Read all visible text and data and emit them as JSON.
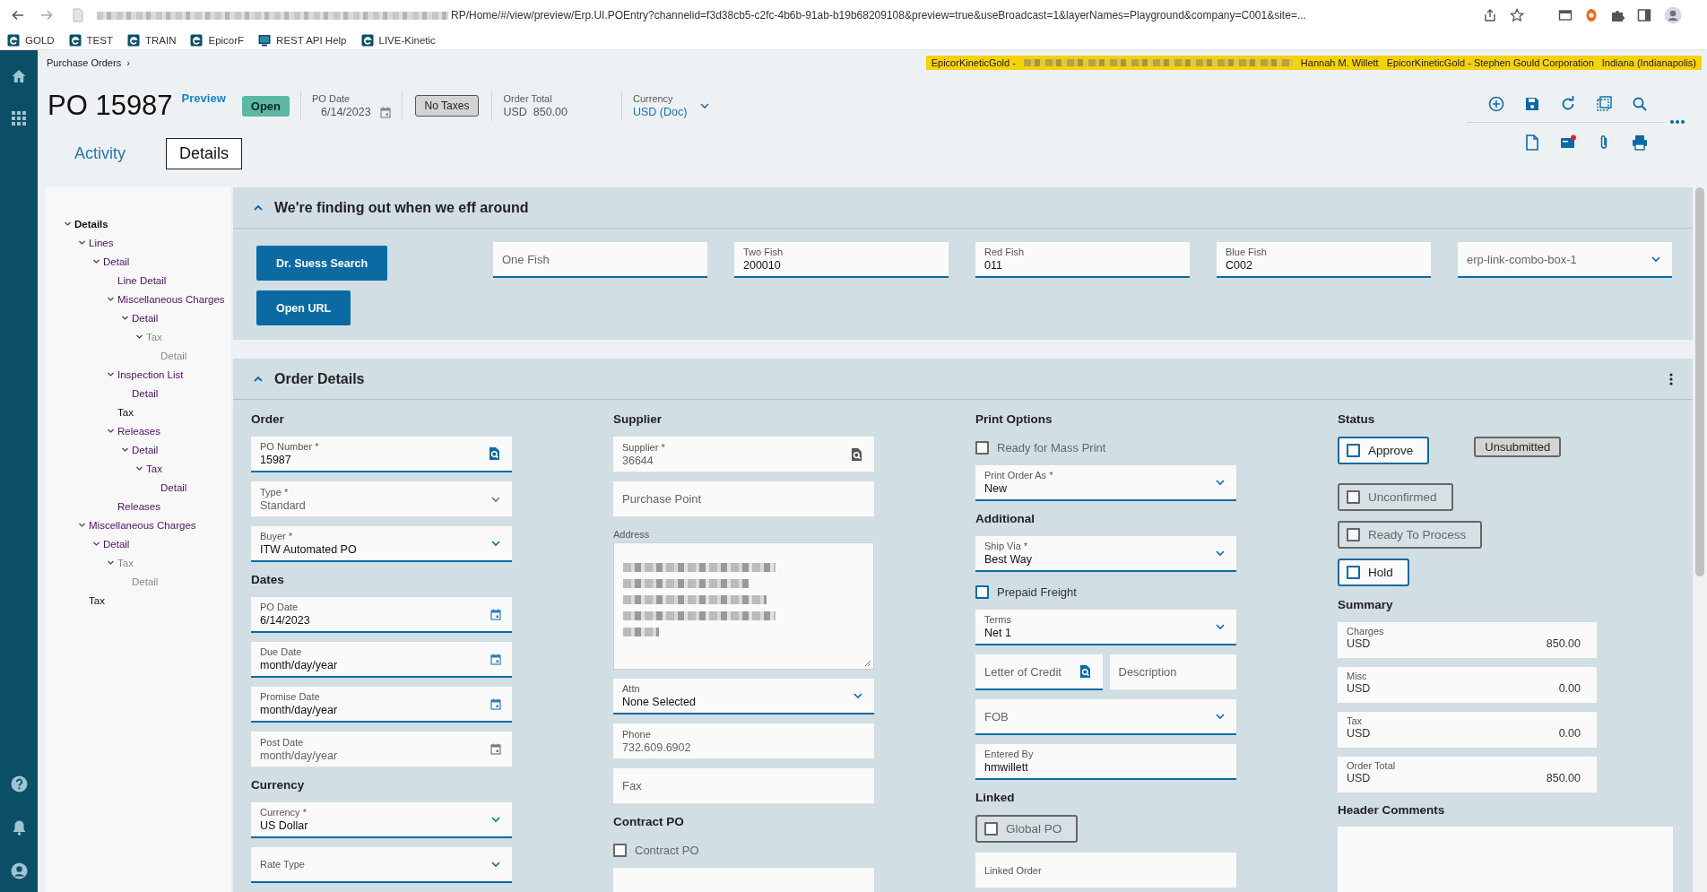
{
  "browser": {
    "url": "RP/Home/#/view/preview/Erp.UI.POEntry?channelid=f3d38cb5-c2fc-4b6b-91ab-b19b68209108&preview=true&useBroadcast=1&layerNames=Playground&company=C001&site=...",
    "bookmarks": [
      {
        "label": "GOLD",
        "kind": "app"
      },
      {
        "label": "TEST",
        "kind": "app"
      },
      {
        "label": "TRAIN",
        "kind": "app"
      },
      {
        "label": "EpicorF",
        "kind": "app"
      },
      {
        "label": "REST API Help",
        "kind": "doc"
      },
      {
        "label": "LIVE-Kinetic",
        "kind": "app"
      }
    ]
  },
  "breadcrumb": {
    "label": "Purchase Orders",
    "separator": "›"
  },
  "banner": {
    "environment": "EpicorKineticGold -",
    "user": "Hannah M. Willett",
    "company": "EpicorKineticGold - Stephen Gould Corporation",
    "site": "Indiana (Indianapolis)"
  },
  "header": {
    "title": "PO 15987",
    "mode": "Preview",
    "status": "Open",
    "po_date": {
      "label": "PO Date",
      "value": "6/14/2023"
    },
    "tax_button": "No Taxes",
    "order_total": {
      "label": "Order Total",
      "value": "USD  850.00"
    },
    "currency": {
      "label": "Currency",
      "value": "USD (Doc)"
    }
  },
  "tabs": [
    {
      "label": "Activity",
      "selected": false
    },
    {
      "label": "Details",
      "selected": true
    }
  ],
  "tree": [
    {
      "label": "Details",
      "selected": true,
      "visited": false,
      "disabled": false,
      "expanded": true,
      "children": [
        {
          "label": "Lines",
          "selected": false,
          "visited": true,
          "disabled": false,
          "expanded": true,
          "children": [
            {
              "label": "Detail",
              "selected": false,
              "visited": true,
              "disabled": false,
              "expanded": true,
              "children": [
                {
                  "label": "Line Detail",
                  "selected": false,
                  "visited": true,
                  "disabled": false
                },
                {
                  "label": "Miscellaneous Charges",
                  "selected": false,
                  "visited": true,
                  "disabled": false,
                  "expanded": true,
                  "children": [
                    {
                      "label": "Detail",
                      "selected": false,
                      "visited": true,
                      "disabled": false,
                      "expanded": true,
                      "children": [
                        {
                          "label": "Tax",
                          "selected": false,
                          "visited": false,
                          "disabled": true,
                          "expanded": true,
                          "children": [
                            {
                              "label": "Detail",
                              "selected": false,
                              "visited": false,
                              "disabled": true
                            }
                          ]
                        }
                      ]
                    }
                  ]
                },
                {
                  "label": "Inspection List",
                  "selected": false,
                  "visited": true,
                  "disabled": false,
                  "expanded": true,
                  "children": [
                    {
                      "label": "Detail",
                      "selected": false,
                      "visited": true,
                      "disabled": false
                    }
                  ]
                },
                {
                  "label": "Tax",
                  "selected": false,
                  "visited": false,
                  "disabled": false
                },
                {
                  "label": "Releases",
                  "selected": false,
                  "visited": true,
                  "disabled": false,
                  "expanded": true,
                  "children": [
                    {
                      "label": "Detail",
                      "selected": false,
                      "visited": true,
                      "disabled": false,
                      "expanded": true,
                      "children": [
                        {
                          "label": "Tax",
                          "selected": false,
                          "visited": true,
                          "disabled": false,
                          "expanded": true,
                          "children": [
                            {
                              "label": "Detail",
                              "selected": false,
                              "visited": true,
                              "disabled": false
                            }
                          ]
                        }
                      ]
                    }
                  ]
                },
                {
                  "label": "Releases",
                  "selected": false,
                  "visited": true,
                  "disabled": false
                }
              ]
            }
          ]
        },
        {
          "label": "Miscellaneous Charges",
          "selected": false,
          "visited": true,
          "disabled": false,
          "expanded": true,
          "children": [
            {
              "label": "Detail",
              "selected": false,
              "visited": true,
              "disabled": false,
              "expanded": true,
              "children": [
                {
                  "label": "Tax",
                  "selected": false,
                  "visited": false,
                  "disabled": true,
                  "expanded": true,
                  "children": [
                    {
                      "label": "Detail",
                      "selected": false,
                      "visited": false,
                      "disabled": true
                    }
                  ]
                }
              ]
            }
          ]
        },
        {
          "label": "Tax",
          "selected": false,
          "visited": false,
          "disabled": false
        }
      ]
    }
  ],
  "panels": [
    {
      "title": "We're finding out when we eff around",
      "expanded": true,
      "buttons": [
        "Dr. Suess Search",
        "Open URL"
      ],
      "fields": [
        {
          "kind": "text",
          "placeholder": "One Fish",
          "disabled": false
        },
        {
          "kind": "text",
          "label": "Two Fish",
          "value": "200010",
          "disabled": false
        },
        {
          "kind": "text",
          "label": "Red Fish",
          "value": "011",
          "disabled": false
        },
        {
          "kind": "text",
          "label": "Blue Fish",
          "value": "C002",
          "disabled": false
        },
        {
          "kind": "dropdown",
          "placeholder": "erp-link-combo-box-1",
          "disabled": false
        }
      ]
    },
    {
      "title": "Order Details",
      "expanded": true,
      "columns": [
        [
          {
            "heading": "Order",
            "items": [
              {
                "kind": "lookup",
                "label": "PO Number *",
                "value": "15987",
                "disabled": false
              },
              {
                "kind": "dropdown",
                "label": "Type *",
                "value": "Standard",
                "disabled": true
              },
              {
                "kind": "dropdown",
                "label": "Buyer *",
                "value": "ITW Automated PO",
                "disabled": false
              }
            ]
          },
          {
            "heading": "Dates",
            "items": [
              {
                "kind": "date",
                "label": "PO Date",
                "value": "6/14/2023",
                "disabled": false
              },
              {
                "kind": "date",
                "label": "Due Date",
                "placeholder": "month/day/year",
                "disabled": false
              },
              {
                "kind": "date",
                "label": "Promise Date",
                "placeholder": "month/day/year",
                "disabled": false
              },
              {
                "kind": "date",
                "label": "Post Date",
                "placeholder": "month/day/year",
                "disabled": true
              }
            ]
          },
          {
            "heading": "Currency",
            "items": [
              {
                "kind": "dropdown",
                "label": "Currency *",
                "value": "US Dollar",
                "disabled": false
              },
              {
                "kind": "dropdown",
                "label": "Rate Type",
                "disabled": false
              }
            ]
          }
        ],
        [
          {
            "heading": "Supplier",
            "items": [
              {
                "kind": "lookup",
                "label": "Supplier *",
                "value": "36644",
                "disabled": true
              },
              {
                "kind": "text",
                "placeholder": "Purchase Point",
                "disabled": true
              },
              {
                "kind": "address",
                "label": "Address",
                "disabled": false
              },
              {
                "kind": "dropdown",
                "label": "Attn",
                "value": "None Selected",
                "disabled": false
              },
              {
                "kind": "text",
                "label": "Phone",
                "value": "732.609.6902",
                "disabled": true
              },
              {
                "kind": "text",
                "placeholder": "Fax",
                "disabled": true
              }
            ]
          },
          {
            "heading": "Contract PO",
            "items": [
              {
                "kind": "checkbox",
                "label": "Contract PO",
                "checked": false,
                "disabled": true
              },
              {
                "kind": "text",
                "disabled": true
              }
            ]
          }
        ],
        [
          {
            "heading": "Print Options",
            "items": [
              {
                "kind": "checkbox",
                "label": "Ready for Mass Print",
                "checked": false,
                "disabled": true
              },
              {
                "kind": "dropdown",
                "label": "Print Order As *",
                "value": "New",
                "disabled": false
              }
            ]
          },
          {
            "heading": "Additional",
            "items": [
              {
                "kind": "dropdown",
                "label": "Ship Via *",
                "value": "Best Way",
                "disabled": false
              },
              {
                "kind": "checkbox",
                "label": "Prepaid Freight",
                "checked": false,
                "disabled": false
              },
              {
                "kind": "dropdown",
                "label": "Terms",
                "value": "Net 1",
                "disabled": false
              },
              {
                "kind": "pair",
                "fields": [
                  {
                    "kind": "lookup",
                    "placeholder": "Letter of Credit",
                    "disabled": false
                  },
                  {
                    "kind": "text",
                    "placeholder": "Description",
                    "disabled": true
                  }
                ]
              },
              {
                "kind": "dropdown",
                "placeholder": "FOB",
                "disabled": false
              },
              {
                "kind": "text",
                "label": "Entered By",
                "value": "hmwillett",
                "disabled": false
              }
            ]
          },
          {
            "heading": "Linked",
            "items": [
              {
                "kind": "toggle",
                "label": "Global PO",
                "checked": false,
                "disabled": true
              },
              {
                "kind": "text",
                "label": "Linked Order",
                "disabled": true
              }
            ]
          }
        ],
        [
          {
            "heading": "Status",
            "items": [
              {
                "kind": "toggle",
                "label": "Approve",
                "checked": false,
                "disabled": false,
                "badge": "Unsubmitted"
              },
              {
                "kind": "toggle",
                "label": "Unconfirmed",
                "checked": false,
                "disabled": true
              },
              {
                "kind": "toggle",
                "label": "Ready To Process",
                "checked": false,
                "disabled": true
              },
              {
                "kind": "toggle",
                "label": "Hold",
                "checked": false,
                "disabled": false
              }
            ]
          },
          {
            "heading": "Summary",
            "items": [
              {
                "kind": "summary",
                "label": "Charges",
                "currency": "USD",
                "value": "850.00"
              },
              {
                "kind": "summary",
                "label": "Misc",
                "currency": "USD",
                "value": "0.00"
              },
              {
                "kind": "summary",
                "label": "Tax",
                "currency": "USD",
                "value": "0.00"
              },
              {
                "kind": "summary",
                "label": "Order Total",
                "currency": "USD",
                "value": "850.00"
              }
            ]
          },
          {
            "heading": "Header Comments",
            "items": [
              {
                "kind": "textarea",
                "disabled": false
              }
            ]
          }
        ]
      ]
    }
  ]
}
